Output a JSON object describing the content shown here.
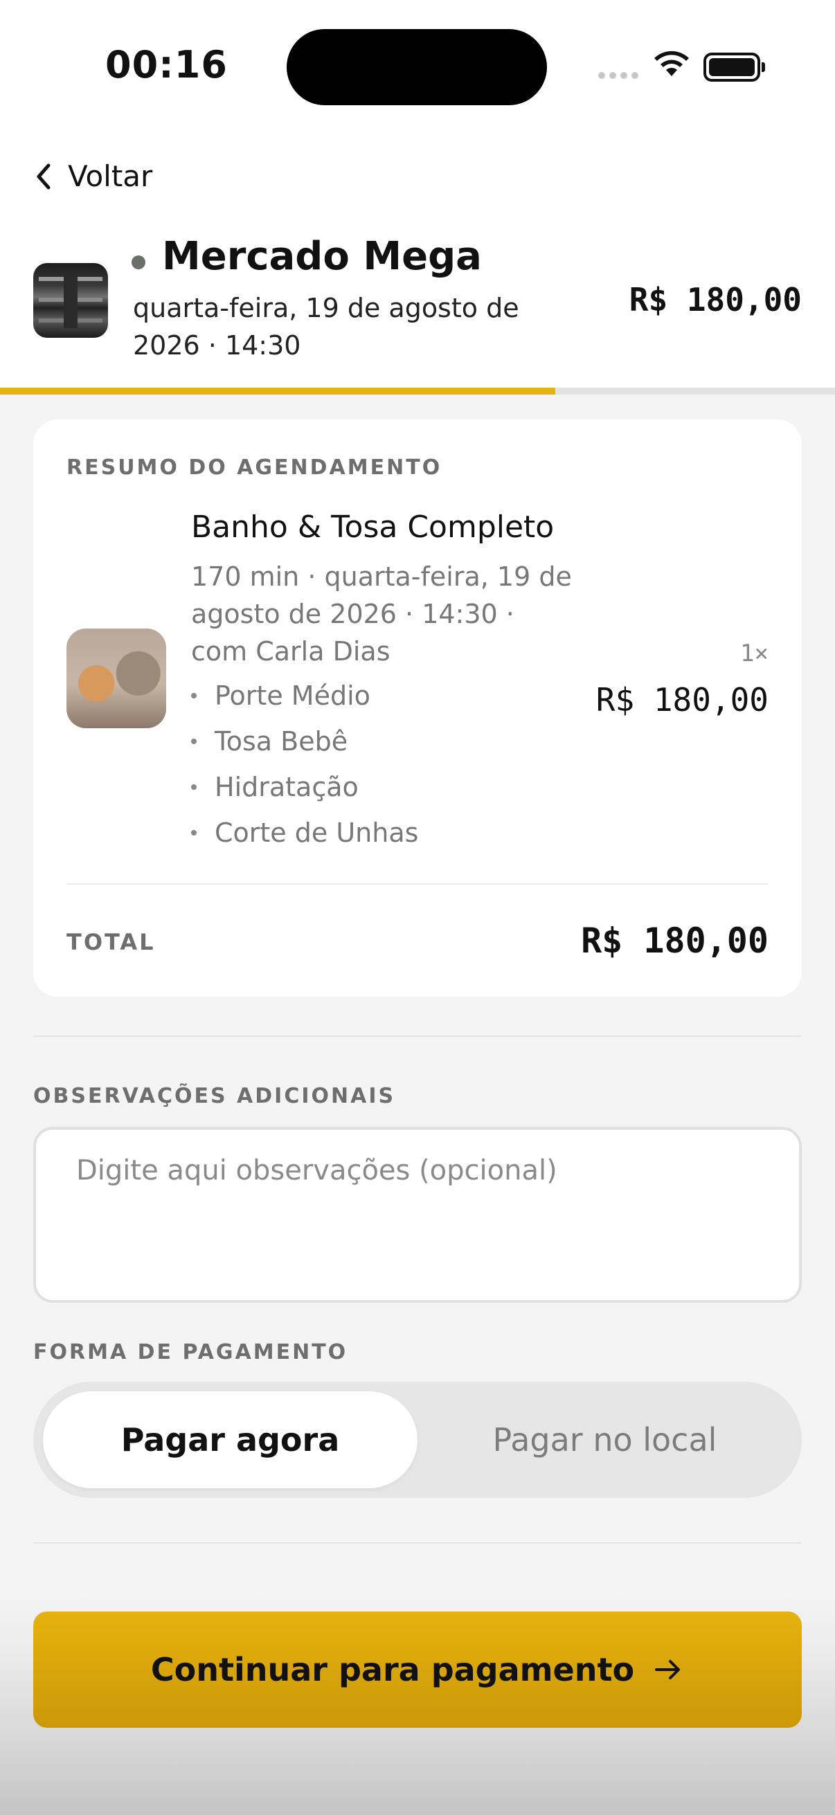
{
  "status_bar": {
    "time": "00:16"
  },
  "header": {
    "back_label": "Voltar",
    "store_name": "Mercado Mega",
    "date_time": "quarta-feira, 19 de agosto de 2026 · 14:30",
    "price": "R$ 180,00",
    "progress_fraction": 0.665
  },
  "summary": {
    "title": "RESUMO DO AGENDAMENTO",
    "service_name": "Banho & Tosa Completo",
    "service_meta": "170 min · quarta-feira, 19 de agosto de 2026 · 14:30 · com Carla Dias",
    "addons": [
      "Porte Médio",
      "Tosa Bebê",
      "Hidratação",
      "Corte de Unhas"
    ],
    "quantity": "1×",
    "item_price": "R$ 180,00",
    "total_label": "TOTAL",
    "total_value": "R$ 180,00"
  },
  "observations": {
    "label": "OBSERVAÇÕES ADICIONAIS",
    "value": "",
    "placeholder": "Digite aqui observações (opcional)"
  },
  "payment": {
    "label": "FORMA DE PAGAMENTO",
    "options": [
      "Pagar agora",
      "Pagar no local"
    ],
    "selected": "Pagar agora"
  },
  "cta": {
    "label": "Continuar para pagamento"
  },
  "colors": {
    "accent": "#e3b213",
    "button": "#d7a50a"
  }
}
